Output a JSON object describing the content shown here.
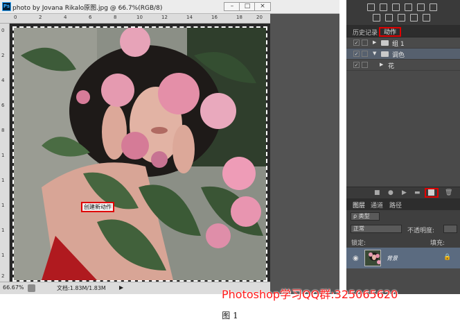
{
  "document": {
    "title": "photo by Jovana Rikalo原图.jpg @ 66.7%(RGB/8)",
    "ps_logo": "Ps",
    "window_buttons": {
      "minimize": "–",
      "maximize": "□",
      "close": "×"
    },
    "ruler_top": [
      "0",
      "2",
      "4",
      "6",
      "8",
      "10",
      "12",
      "14",
      "16",
      "18",
      "20"
    ],
    "ruler_left": [
      "0",
      "2",
      "4",
      "6",
      "8",
      "1",
      "1",
      "1",
      "1",
      "1",
      "2"
    ],
    "status": {
      "zoom": "66.67%",
      "doc_size": "文档:1.83M/1.83M",
      "arrow": "▶"
    }
  },
  "panels": {
    "history_tab": "历史记录",
    "actions_tab": "动作",
    "actions": [
      {
        "check": "✓",
        "expand": "▶",
        "type": "folder",
        "label": "组 1"
      },
      {
        "check": "✓",
        "expand": "▼",
        "type": "folder",
        "label": "调色"
      },
      {
        "check": "✓",
        "expand": "▶",
        "type": "action",
        "label": "花"
      }
    ],
    "bottom_buttons": {
      "stop": "■",
      "record": "●",
      "play": "▶",
      "new_set": "▬",
      "delete": "🗑"
    },
    "tooltip": "创建新动作",
    "layers_tabs": [
      "图层",
      "通道",
      "路径"
    ],
    "filter_kind": "ρ 类型",
    "blend_mode": "正常",
    "opacity_label": "不透明度:",
    "lock_label": "锁定:",
    "fill_label": "填充:",
    "layer": {
      "name": "背景",
      "eye": "◉",
      "lock": "🔒"
    }
  },
  "watermark": "Photoshop学习QQ群:325065620",
  "caption": "图 1",
  "colors": {
    "highlight": "#e00000",
    "watermark": "#ff1a1a",
    "panel_bg": "#3a3a3a",
    "layer_selected": "#5b6b80"
  }
}
